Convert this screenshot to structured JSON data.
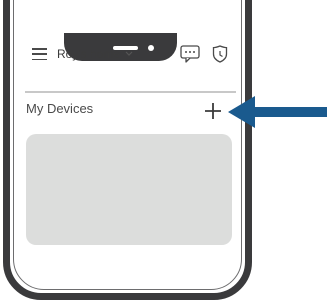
{
  "header": {
    "home_name": "Roy's home",
    "menu_icon": "hamburger-menu-icon",
    "dropdown_icon": "chevron-down-icon",
    "message_icon": "chat-bubble-icon",
    "shield_icon": "shield-icon"
  },
  "section": {
    "title": "My Devices",
    "add_icon": "plus-icon"
  },
  "colors": {
    "phone_frame": "#3a3a3c",
    "card": "#dcdddc",
    "arrow": "#1a5a8e"
  }
}
